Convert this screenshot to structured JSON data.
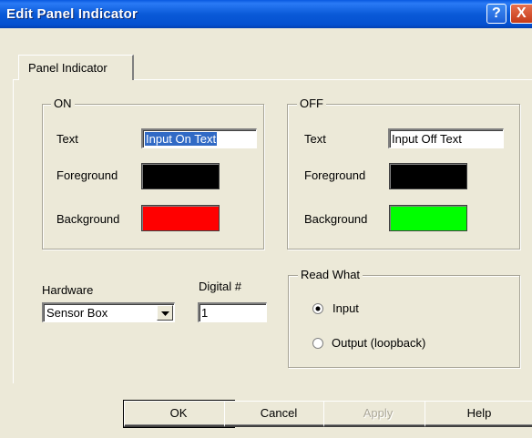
{
  "window": {
    "title": "Edit Panel Indicator",
    "help_glyph": "?",
    "close_glyph": "X"
  },
  "tabs": [
    {
      "label": "Panel Indicator",
      "active": true
    }
  ],
  "on_group": {
    "title": "ON",
    "text_label": "Text",
    "text_value": "Input On Text",
    "foreground_label": "Foreground",
    "foreground_color": "#000000",
    "background_label": "Background",
    "background_color": "#ff0000"
  },
  "off_group": {
    "title": "OFF",
    "text_label": "Text",
    "text_value": "Input Off Text",
    "foreground_label": "Foreground",
    "foreground_color": "#000000",
    "background_label": "Background",
    "background_color": "#00ff00"
  },
  "hardware": {
    "label": "Hardware",
    "selected": "Sensor Box"
  },
  "digital": {
    "label": "Digital #",
    "value": "1"
  },
  "read_what": {
    "title": "Read What",
    "options": [
      {
        "label": "Input",
        "checked": true
      },
      {
        "label": "Output (loopback)",
        "checked": false
      }
    ]
  },
  "buttons": {
    "ok": "OK",
    "cancel": "Cancel",
    "apply": "Apply",
    "help": "Help"
  }
}
